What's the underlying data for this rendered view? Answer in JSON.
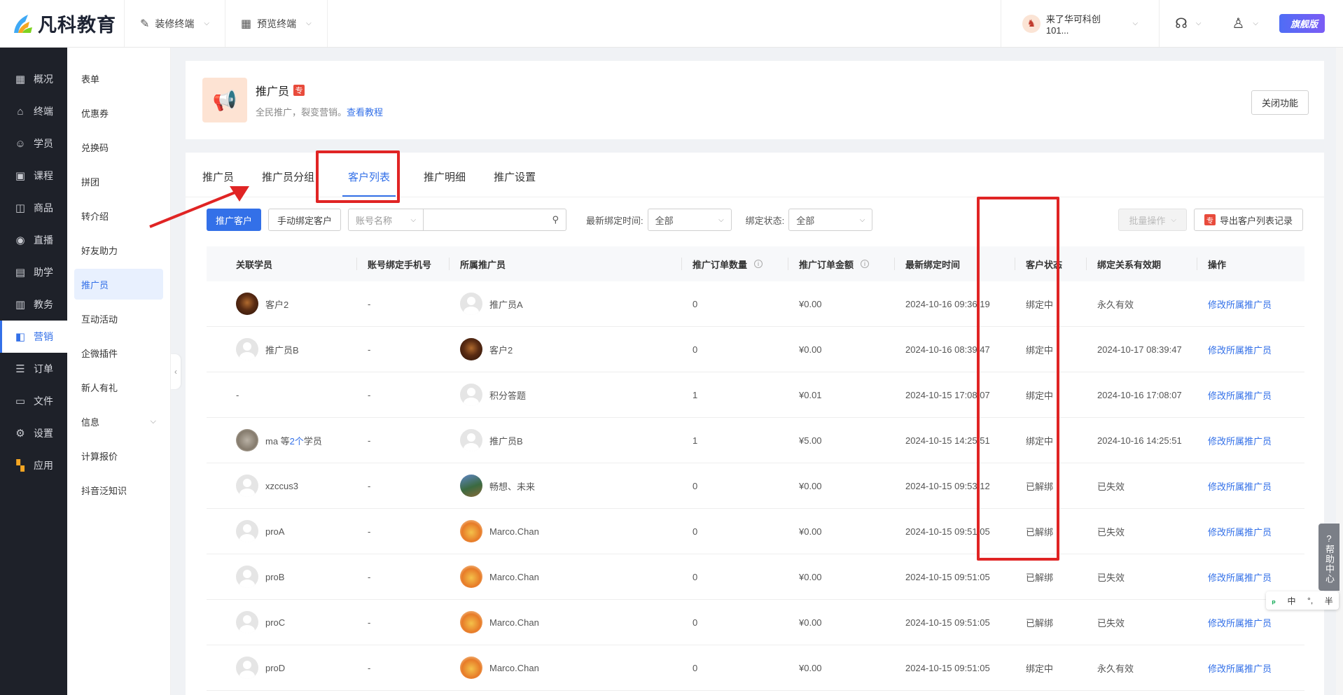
{
  "brand": {
    "name": "凡科教育"
  },
  "topbar": {
    "menu1": "装修终端",
    "menu2": "预览终端",
    "account": "来了华可科创101...",
    "edition": "旗舰版"
  },
  "leftnav": {
    "items": [
      {
        "label": "概况",
        "icon": "dashboard-icon"
      },
      {
        "label": "终端",
        "icon": "store-icon"
      },
      {
        "label": "学员",
        "icon": "users-icon"
      },
      {
        "label": "课程",
        "icon": "course-icon"
      },
      {
        "label": "商品",
        "icon": "goods-icon"
      },
      {
        "label": "直播",
        "icon": "live-icon"
      },
      {
        "label": "助学",
        "icon": "study-icon"
      },
      {
        "label": "教务",
        "icon": "academic-icon"
      },
      {
        "label": "营销",
        "icon": "marketing-icon"
      },
      {
        "label": "订单",
        "icon": "order-icon"
      },
      {
        "label": "文件",
        "icon": "folder-icon"
      },
      {
        "label": "设置",
        "icon": "settings-icon"
      },
      {
        "label": "应用",
        "icon": "apps-icon"
      }
    ],
    "active": "营销"
  },
  "subnav": {
    "items": [
      "表单",
      "优惠券",
      "兑换码",
      "拼团",
      "转介绍",
      "好友助力",
      "推广员",
      "互动活动",
      "企微插件",
      "新人有礼",
      "信息",
      "计算报价",
      "抖音泛知识"
    ],
    "active": "推广员"
  },
  "header": {
    "title": "推广员",
    "badge": "专",
    "subtitle": "全民推广，裂变营销。",
    "tutorial_link": "查看教程",
    "close_button": "关闭功能"
  },
  "tabs": {
    "items": [
      "推广员",
      "推广员分组",
      "客户列表",
      "推广明细",
      "推广设置"
    ],
    "active": "客户列表"
  },
  "filters": {
    "promote_button": "推广客户",
    "bind_button": "手动绑定客户",
    "search_type": "账号名称",
    "search_value": "",
    "bind_time_label": "最新绑定时间:",
    "bind_time_value": "全部",
    "bind_status_label": "绑定状态:",
    "bind_status_value": "全部",
    "batch_button": "批量操作",
    "export_badge": "专",
    "export_button": "导出客户列表记录"
  },
  "table": {
    "columns": [
      "关联学员",
      "账号绑定手机号",
      "所属推广员",
      "推广订单数量",
      "推广订单金额",
      "最新绑定时间",
      "客户状态",
      "绑定关系有效期",
      "操作"
    ],
    "rows": [
      {
        "student": "客户2",
        "student_avatar": "dark",
        "phone": "-",
        "promoter": "推广员A",
        "promoter_avatar": "default",
        "orders": "0",
        "amount": "¥0.00",
        "bind_time": "2024-10-16 09:36:19",
        "status": "绑定中",
        "validity": "永久有效",
        "action": "修改所属推广员"
      },
      {
        "student": "推广员B",
        "student_avatar": "default",
        "phone": "-",
        "promoter": "客户2",
        "promoter_avatar": "dark",
        "orders": "0",
        "amount": "¥0.00",
        "bind_time": "2024-10-16 08:39:47",
        "status": "绑定中",
        "validity": "2024-10-17 08:39:47",
        "action": "修改所属推广员"
      },
      {
        "student": "-",
        "student_avatar": "",
        "phone": "-",
        "promoter": "积分答题",
        "promoter_avatar": "default",
        "orders": "1",
        "amount": "¥0.01",
        "bind_time": "2024-10-15 17:08:07",
        "status": "绑定中",
        "validity": "2024-10-16 17:08:07",
        "action": "修改所属推广员"
      },
      {
        "student": "ma 等",
        "student_extra": "2个",
        "student_suffix": "学员",
        "student_avatar": "cat",
        "phone": "-",
        "promoter": "推广员B",
        "promoter_avatar": "default",
        "orders": "1",
        "amount": "¥5.00",
        "bind_time": "2024-10-15 14:25:51",
        "status": "绑定中",
        "validity": "2024-10-16 14:25:51",
        "action": "修改所属推广员"
      },
      {
        "student": "xzccus3",
        "student_avatar": "default",
        "phone": "-",
        "promoter": "畅想、未来",
        "promoter_avatar": "scene",
        "orders": "0",
        "amount": "¥0.00",
        "bind_time": "2024-10-15 09:53:12",
        "status": "已解绑",
        "validity": "已失效",
        "action": "修改所属推广员"
      },
      {
        "student": "proA",
        "student_avatar": "default",
        "phone": "-",
        "promoter": "Marco.Chan",
        "promoter_avatar": "tiger",
        "orders": "0",
        "amount": "¥0.00",
        "bind_time": "2024-10-15 09:51:05",
        "status": "已解绑",
        "validity": "已失效",
        "action": "修改所属推广员"
      },
      {
        "student": "proB",
        "student_avatar": "default",
        "phone": "-",
        "promoter": "Marco.Chan",
        "promoter_avatar": "tiger",
        "orders": "0",
        "amount": "¥0.00",
        "bind_time": "2024-10-15 09:51:05",
        "status": "已解绑",
        "validity": "已失效",
        "action": "修改所属推广员"
      },
      {
        "student": "proC",
        "student_avatar": "default",
        "phone": "-",
        "promoter": "Marco.Chan",
        "promoter_avatar": "tiger",
        "orders": "0",
        "amount": "¥0.00",
        "bind_time": "2024-10-15 09:51:05",
        "status": "已解绑",
        "validity": "已失效",
        "action": "修改所属推广员"
      },
      {
        "student": "proD",
        "student_avatar": "default",
        "phone": "-",
        "promoter": "Marco.Chan",
        "promoter_avatar": "tiger",
        "orders": "0",
        "amount": "¥0.00",
        "bind_time": "2024-10-15 09:51:05",
        "status": "绑定中",
        "validity": "永久有效",
        "action": "修改所属推广员"
      }
    ]
  },
  "help": {
    "label": "帮助中心"
  },
  "ime": {
    "items": [
      "中",
      "°,",
      "半"
    ]
  },
  "colors": {
    "primary": "#3370e8",
    "annotation": "#e02424",
    "sidebar": "#1e2129"
  }
}
